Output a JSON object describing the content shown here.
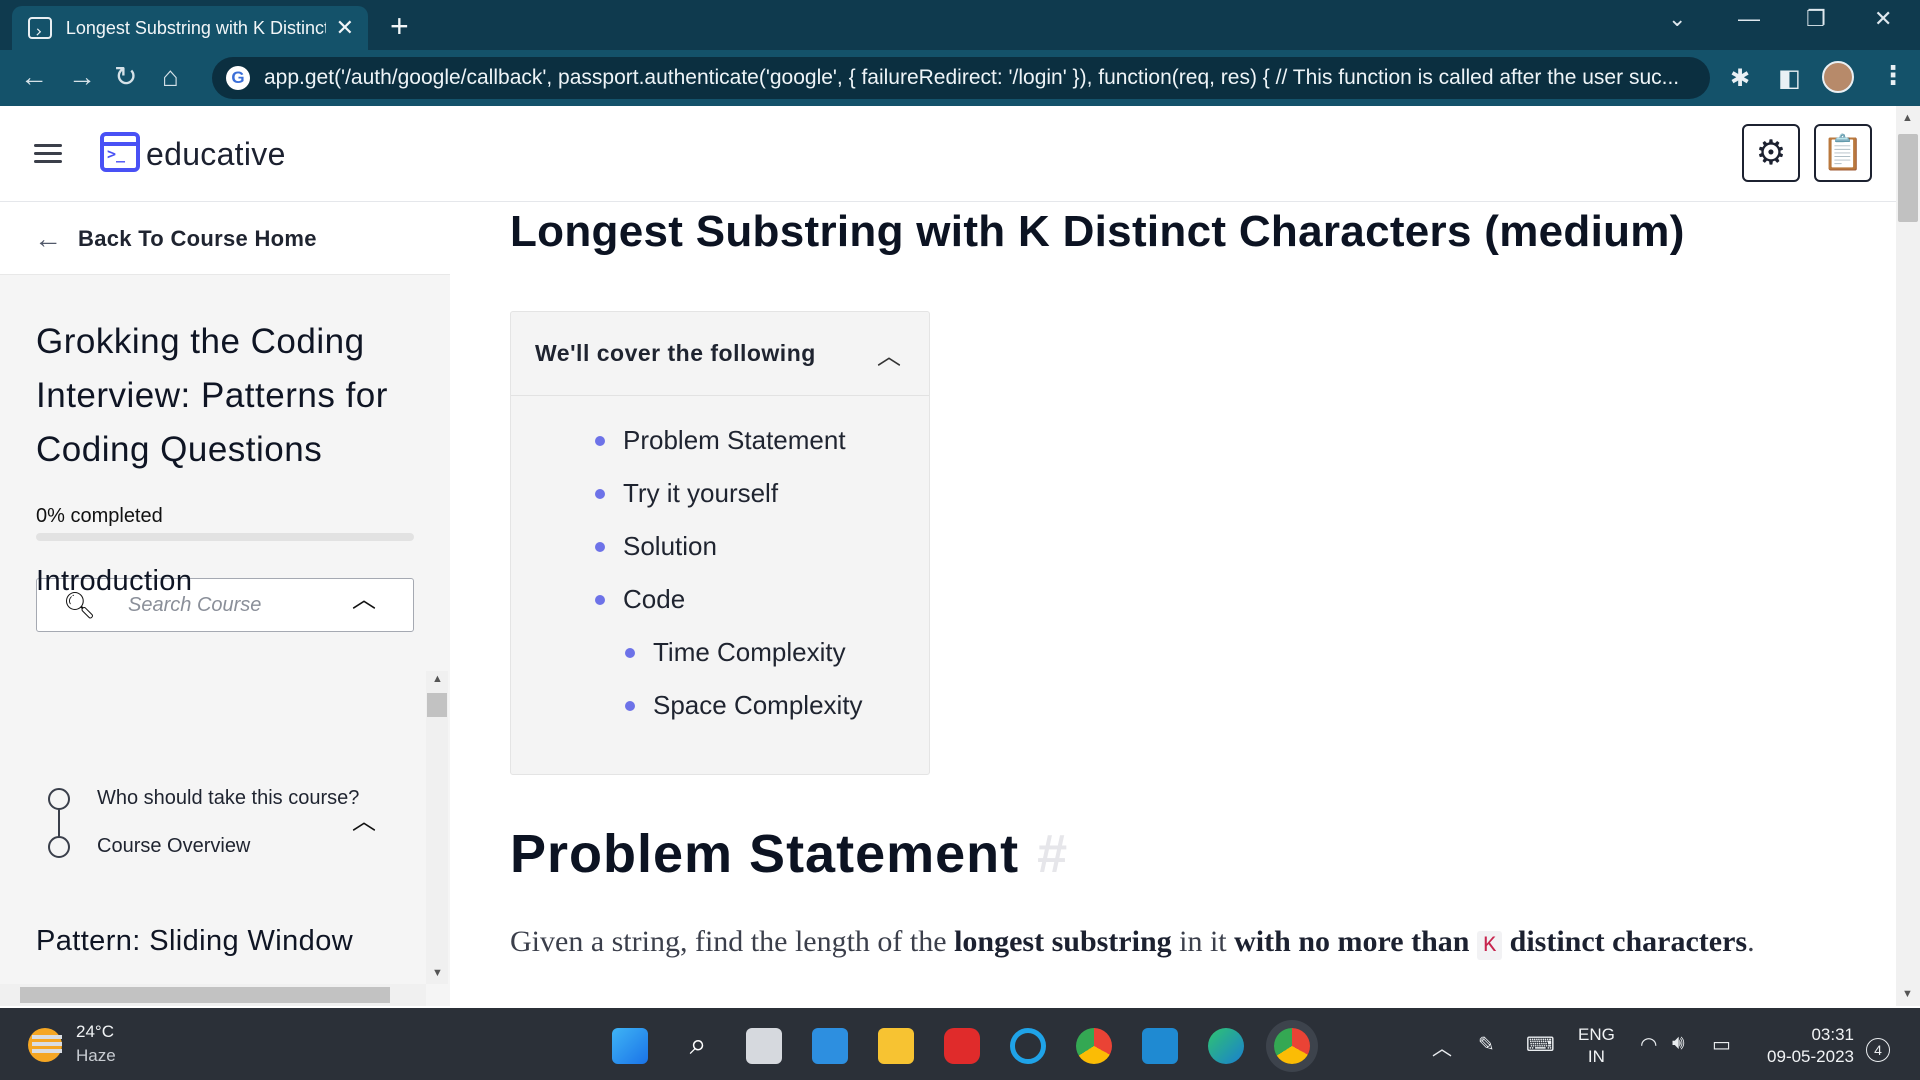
{
  "browser": {
    "tab_title": "Longest Substring with K Distinct Characters",
    "url": "app.get('/auth/google/callback', passport.authenticate('google', { failureRedirect: '/login' }), function(req, res) { // This function is called after the user suc..."
  },
  "app": {
    "logo_text": "educative",
    "accent": "#4951f5"
  },
  "sidebar": {
    "back_label": "Back To Course Home",
    "course_title": "Grokking the Coding Interview: Patterns for Coding Questions",
    "progress_label": "0% completed",
    "progress_fraction": 0,
    "search_placeholder": "Search Course",
    "sections": [
      {
        "title": "Introduction",
        "lessons": [
          "Who should take this course?",
          "Course Overview"
        ]
      },
      {
        "title": "Pattern: Sliding Window",
        "lessons": []
      }
    ]
  },
  "main": {
    "lesson_title": "Longest Substring with K Distinct Characters (medium)",
    "toc": {
      "heading": "We'll cover the following",
      "items": [
        {
          "label": "Problem Statement",
          "level": 1
        },
        {
          "label": "Try it yourself",
          "level": 1
        },
        {
          "label": "Solution",
          "level": 1
        },
        {
          "label": "Code",
          "level": 1
        },
        {
          "label": "Time Complexity",
          "level": 2
        },
        {
          "label": "Space Complexity",
          "level": 2
        }
      ]
    },
    "problem_heading": "Problem Statement",
    "anchor_symbol": "#",
    "paragraph": {
      "t1": "Given a string, find the length of the ",
      "b1": "longest substring",
      "t2": " in it ",
      "b2": "with no more than",
      "code": "K",
      "b3": "distinct characters",
      "t3": "."
    }
  },
  "taskbar": {
    "temperature": "24°C",
    "weather": "Haze",
    "lang_top": "ENG",
    "lang_bottom": "IN",
    "time": "03:31",
    "date": "09-05-2023",
    "notification_count": "4"
  }
}
